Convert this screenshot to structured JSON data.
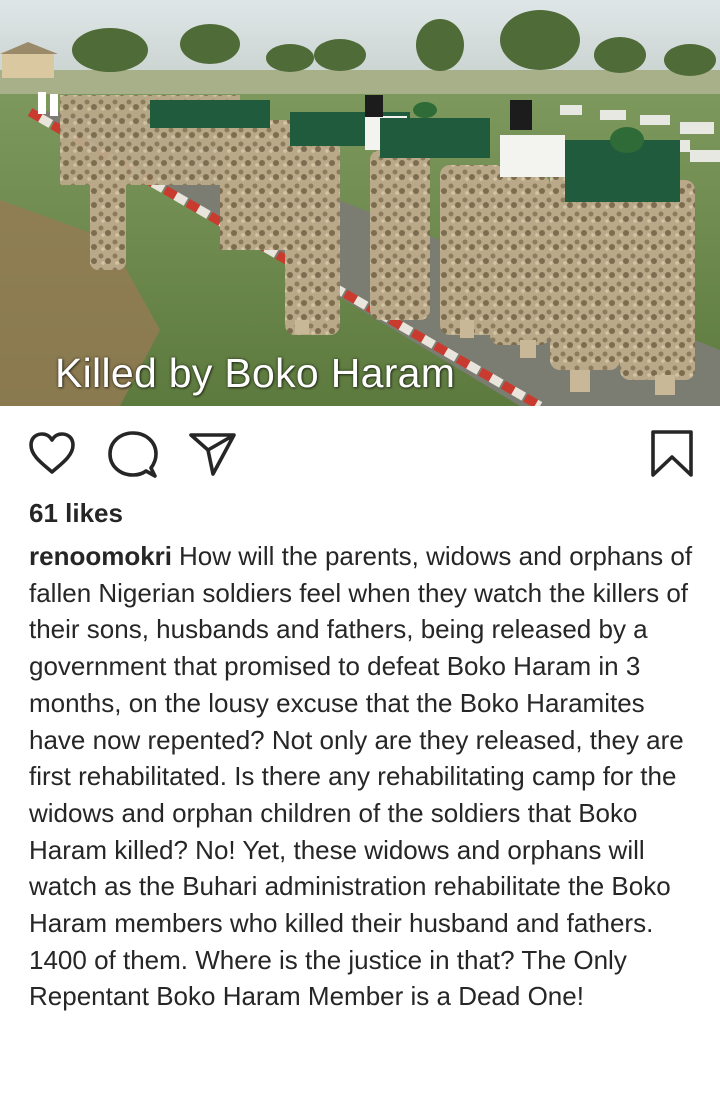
{
  "post": {
    "image_overlay_text": "Killed by Boko Haram",
    "likes": "61 likes",
    "username": "renoomokri",
    "caption": "How will the parents, widows and orphans of fallen Nigerian soldiers feel when they watch the killers of their sons, husbands and fathers, being released by a government that promised to defeat Boko Haram in 3 months, on the lousy excuse that the Boko Haramites have now repented? Not only are they released, they are first rehabilitated. Is there any rehabilitating camp for the widows and orphan children of the soldiers that Boko Haram killed? No! Yet, these widows and orphans will watch as the Buhari administration rehabilitate the Boko Haram members who killed their husband and fathers. 1400 of them. Where is the justice in that? The Only Repentant Boko Haram Member is a Dead One!"
  },
  "actions": {
    "like_icon": "heart-icon",
    "comment_icon": "comment-bubble-icon",
    "share_icon": "paper-plane-icon",
    "save_icon": "bookmark-icon"
  },
  "colors": {
    "text": "#262626",
    "icon": "#262626",
    "background": "#ffffff"
  }
}
